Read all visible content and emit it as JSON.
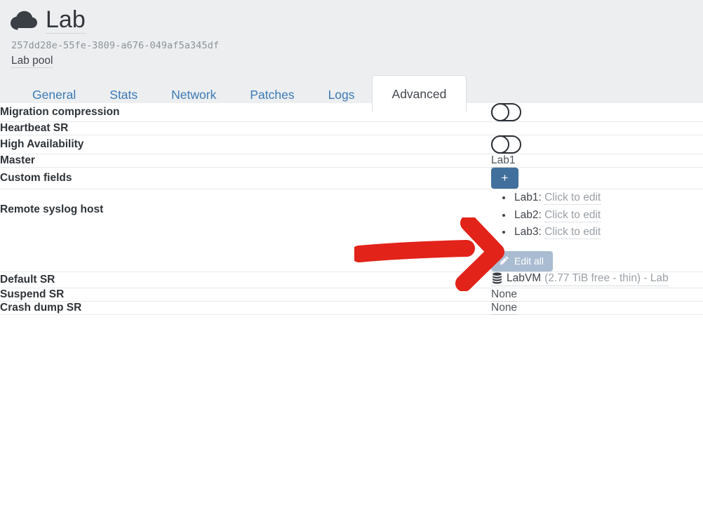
{
  "header": {
    "icon": "cloud-icon",
    "title": "Lab",
    "uuid": "257dd28e-55fe-3809-a676-049af5a345df",
    "description": "Lab pool"
  },
  "tabs": [
    {
      "label": "General",
      "active": false
    },
    {
      "label": "Stats",
      "active": false
    },
    {
      "label": "Network",
      "active": false
    },
    {
      "label": "Patches",
      "active": false
    },
    {
      "label": "Logs",
      "active": false
    },
    {
      "label": "Advanced",
      "active": true
    }
  ],
  "rows": {
    "migration_compression": {
      "label": "Migration compression",
      "toggle": "off"
    },
    "heartbeat_sr": {
      "label": "Heartbeat SR",
      "value": ""
    },
    "high_availability": {
      "label": "High Availability",
      "toggle": "off"
    },
    "master": {
      "label": "Master",
      "value": "Lab1"
    },
    "custom_fields": {
      "label": "Custom fields",
      "add_button": "+"
    },
    "remote_syslog_host": {
      "label": "Remote syslog host",
      "entries": [
        {
          "host": "Lab1:",
          "action": "Click to edit"
        },
        {
          "host": "Lab2:",
          "action": "Click to edit"
        },
        {
          "host": "Lab3:",
          "action": "Click to edit"
        }
      ],
      "edit_all_label": "Edit all",
      "edit_all_icon": "pencil-icon"
    },
    "default_sr": {
      "label": "Default SR",
      "icon": "database-icon",
      "name": "LabVM",
      "detail": "(2.77 TiB free - thin) - Lab"
    },
    "suspend_sr": {
      "label": "Suspend SR",
      "value": "None"
    },
    "crash_dump_sr": {
      "label": "Crash dump SR",
      "value": "None"
    }
  },
  "annotation": {
    "type": "red-arrow",
    "direction": "right",
    "points_to": "Master value Lab1",
    "color": "#e2231a"
  },
  "colors": {
    "header_bg": "#eceef0",
    "tab_link": "#3c7ab5",
    "accent_blue": "#41709c",
    "muted_button": "#a9bcd1",
    "annotation_red": "#e2231a"
  }
}
